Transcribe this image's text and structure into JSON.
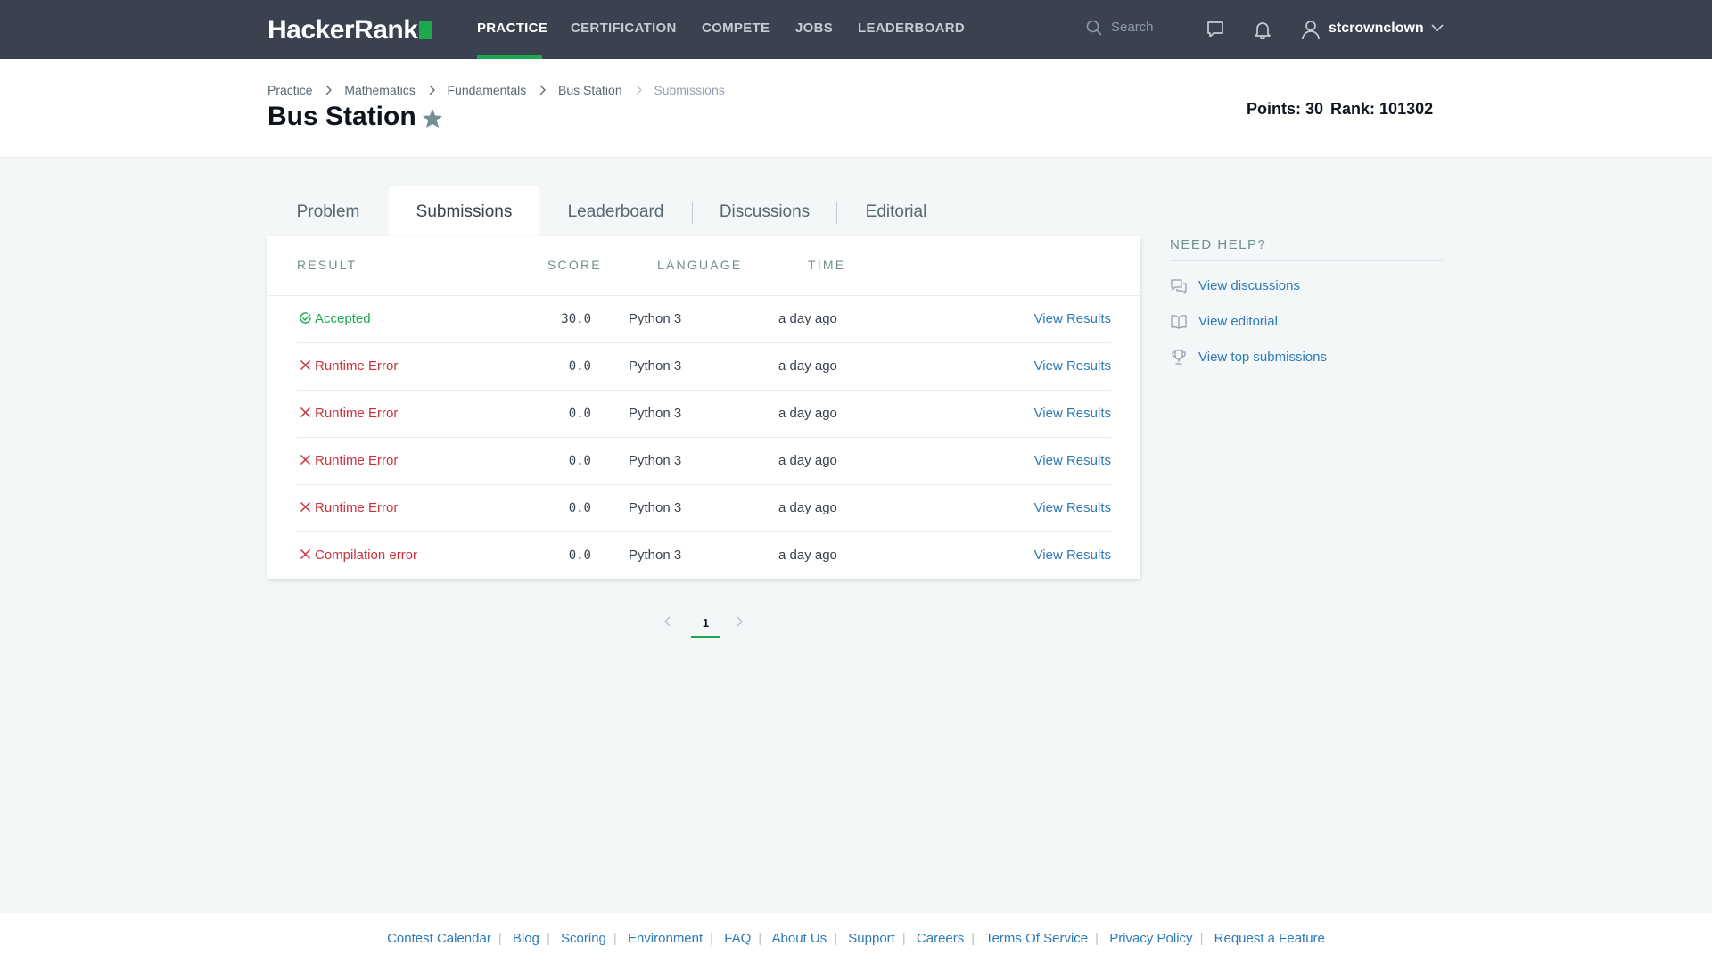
{
  "nav": {
    "brand": "HackerRank",
    "links": [
      "PRACTICE",
      "CERTIFICATION",
      "COMPETE",
      "JOBS",
      "LEADERBOARD"
    ],
    "active": "PRACTICE",
    "search_placeholder": "Search",
    "username": "stcrownclown"
  },
  "breadcrumb": [
    "Practice",
    "Mathematics",
    "Fundamentals",
    "Bus Station",
    "Submissions"
  ],
  "page": {
    "title": "Bus Station",
    "points": "Points: 30",
    "rank": "Rank: 101302"
  },
  "tabs": [
    "Problem",
    "Submissions",
    "Leaderboard",
    "Discussions",
    "Editorial"
  ],
  "active_tab": "Submissions",
  "table": {
    "headers": [
      "RESULT",
      "SCORE",
      "LANGUAGE",
      "TIME"
    ],
    "rows": [
      {
        "result": "Accepted",
        "status": "accepted",
        "score": "30.0",
        "language": "Python 3",
        "time": "a day ago",
        "action": "View Results"
      },
      {
        "result": "Runtime Error",
        "status": "error",
        "score": "0.0",
        "language": "Python 3",
        "time": "a day ago",
        "action": "View Results"
      },
      {
        "result": "Runtime Error",
        "status": "error",
        "score": "0.0",
        "language": "Python 3",
        "time": "a day ago",
        "action": "View Results"
      },
      {
        "result": "Runtime Error",
        "status": "error",
        "score": "0.0",
        "language": "Python 3",
        "time": "a day ago",
        "action": "View Results"
      },
      {
        "result": "Runtime Error",
        "status": "error",
        "score": "0.0",
        "language": "Python 3",
        "time": "a day ago",
        "action": "View Results"
      },
      {
        "result": "Compilation error",
        "status": "error",
        "score": "0.0",
        "language": "Python 3",
        "time": "a day ago",
        "action": "View Results"
      }
    ]
  },
  "pagination": {
    "current": "1"
  },
  "help": {
    "title": "NEED HELP?",
    "links": [
      {
        "label": "View discussions",
        "icon": "discussions-icon"
      },
      {
        "label": "View editorial",
        "icon": "book-icon"
      },
      {
        "label": "View top submissions",
        "icon": "trophy-icon"
      }
    ]
  },
  "footer": [
    "Contest Calendar",
    "Blog",
    "Scoring",
    "Environment",
    "FAQ",
    "About Us",
    "Support",
    "Careers",
    "Terms Of Service",
    "Privacy Policy",
    "Request a Feature"
  ],
  "colors": {
    "nav_bg": "#39424e",
    "accent_green": "#1ba94c",
    "error_red": "#c9323c",
    "link_blue": "#2c7ab8"
  }
}
